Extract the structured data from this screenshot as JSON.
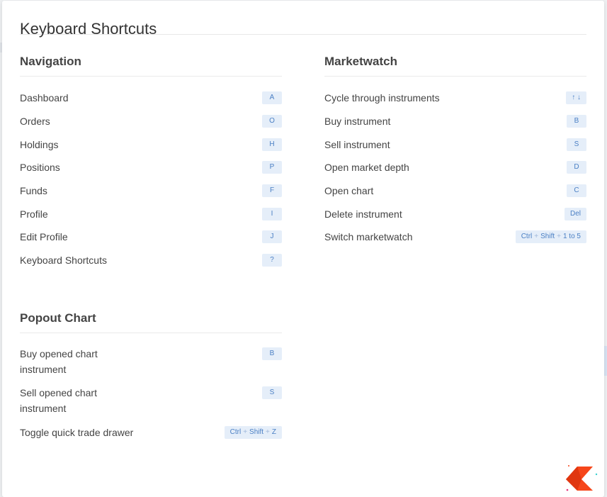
{
  "modal": {
    "title": "Keyboard Shortcuts"
  },
  "sections": {
    "navigation": {
      "title": "Navigation",
      "items": [
        {
          "label": "Dashboard",
          "keys": [
            "A"
          ]
        },
        {
          "label": "Orders",
          "keys": [
            "O"
          ]
        },
        {
          "label": "Holdings",
          "keys": [
            "H"
          ]
        },
        {
          "label": "Positions",
          "keys": [
            "P"
          ]
        },
        {
          "label": "Funds",
          "keys": [
            "F"
          ]
        },
        {
          "label": "Profile",
          "keys": [
            "I"
          ]
        },
        {
          "label": "Edit Profile",
          "keys": [
            "J"
          ]
        },
        {
          "label": "Keyboard Shortcuts",
          "keys": [
            "?"
          ]
        }
      ]
    },
    "marketwatch": {
      "title": "Marketwatch",
      "items": [
        {
          "label": "Cycle through instruments",
          "keys": [
            "↑ ↓"
          ]
        },
        {
          "label": "Buy instrument",
          "keys": [
            "B"
          ]
        },
        {
          "label": "Sell instrument",
          "keys": [
            "S"
          ]
        },
        {
          "label": "Open market depth",
          "keys": [
            "D"
          ]
        },
        {
          "label": "Open chart",
          "keys": [
            "C"
          ]
        },
        {
          "label": "Delete instrument",
          "keys": [
            "Del"
          ]
        },
        {
          "label": "Switch marketwatch",
          "keys": [
            "Ctrl",
            "Shift",
            "1 to 5"
          ]
        }
      ]
    },
    "popout": {
      "title": "Popout Chart",
      "items": [
        {
          "label": "Buy opened chart instrument",
          "keys": [
            "B"
          ]
        },
        {
          "label": "Sell opened chart instrument",
          "keys": [
            "S"
          ]
        },
        {
          "label": "Toggle quick trade drawer",
          "keys": [
            "Ctrl",
            "Shift",
            "Z"
          ]
        }
      ]
    }
  },
  "colors": {
    "key_bg": "#e5eef9",
    "key_text": "#4a7fc4",
    "brand": "#f6461a"
  },
  "icons": {
    "brand_logo": "kite-logo-icon",
    "key_separator": "+"
  }
}
